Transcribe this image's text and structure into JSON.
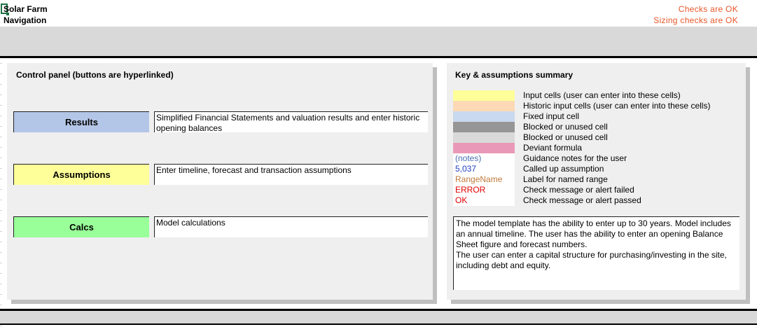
{
  "header": {
    "title": "Solar Farm",
    "subtitle": "Navigation",
    "checks": "Checks are OK",
    "sizing_checks": "Sizing checks are OK"
  },
  "colors": {
    "status_ok": "#e8562a",
    "band": "#d9d9d9",
    "panel": "#efefef",
    "results": "#b4c6e7",
    "assumptions": "#ffff99",
    "calcs": "#99ff99"
  },
  "control_panel": {
    "heading": "Control panel (buttons are hyperlinked)",
    "buttons": [
      {
        "label": "Results",
        "description": "Simplified Financial Statements and valuation results and enter historic opening balances",
        "color": "#b4c6e7"
      },
      {
        "label": "Assumptions",
        "description": "Enter timeline, forecast and transaction assumptions",
        "color": "#ffff99"
      },
      {
        "label": "Calcs",
        "description": "Model calculations",
        "color": "#99ff99"
      }
    ]
  },
  "key": {
    "heading": "Key & assumptions summary",
    "items": [
      {
        "swatch_text": "",
        "swatch_color": "#ffff99",
        "text_color": "#000000",
        "label": "Input cells (user can enter into these cells)"
      },
      {
        "swatch_text": "",
        "swatch_color": "#fdd9b5",
        "text_color": "#000000",
        "label": "Historic input cells (user can enter into these cells)"
      },
      {
        "swatch_text": "",
        "swatch_color": "#c9d9ee",
        "text_color": "#000000",
        "label": "Fixed input cell"
      },
      {
        "swatch_text": "",
        "swatch_color": "#969696",
        "text_color": "#000000",
        "label": "Blocked or unused cell"
      },
      {
        "swatch_text": "",
        "swatch_color": "#d9d9d9",
        "text_color": "#000000",
        "label": "Blocked or unused cell"
      },
      {
        "swatch_text": "",
        "swatch_color": "#e999b7",
        "text_color": "#000000",
        "label": "Deviant formula"
      },
      {
        "swatch_text": "(notes)",
        "swatch_color": "#ffffff",
        "text_color": "#4a6fb0",
        "label": "Guidance notes for the user"
      },
      {
        "swatch_text": "5,037",
        "swatch_color": "#ffffff",
        "text_color": "#1f3fbf",
        "label": "Called up assumption"
      },
      {
        "swatch_text": "RangeName",
        "swatch_color": "#ffffff",
        "text_color": "#c07a3a",
        "label": "Label for named range"
      },
      {
        "swatch_text": "ERROR",
        "swatch_color": "#ffffff",
        "text_color": "#e00000",
        "label": "Check message or alert failed"
      },
      {
        "swatch_text": "OK",
        "swatch_color": "#ffffff",
        "text_color": "#e00000",
        "label": "Check message or alert passed"
      }
    ],
    "summary": [
      "The model template has the ability to enter up to 30 years. Model includes an annual timeline. The user has the ability to enter an opening Balance Sheet figure and forecast numbers.",
      "The user can enter a capital structure for purchasing/investing in the site, including debt and equity."
    ]
  }
}
